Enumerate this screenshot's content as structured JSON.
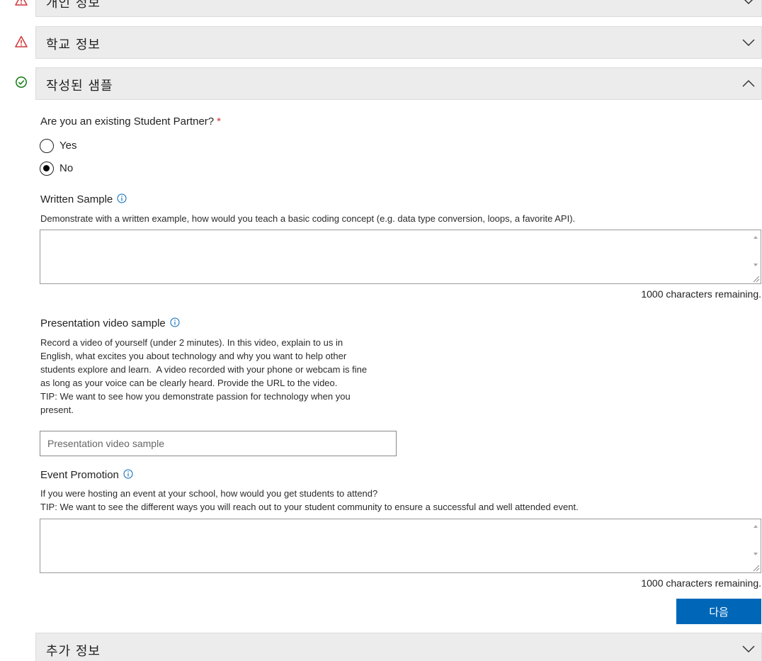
{
  "sections": {
    "personal_info": {
      "title": "개인 정보",
      "status": "warning"
    },
    "school_info": {
      "title": "학교 정보",
      "status": "warning"
    },
    "written_sample": {
      "title": "작성된 샘플",
      "status": "complete"
    },
    "additional_info": {
      "title": "추가 정보"
    }
  },
  "form": {
    "existing_partner": {
      "question": "Are you an existing Student Partner?",
      "required_mark": "*",
      "options": [
        "Yes",
        "No"
      ],
      "selected": "No"
    },
    "written_sample": {
      "label": "Written Sample",
      "description": "Demonstrate with a written example, how would you teach a basic coding concept (e.g. data type conversion, loops, a favorite API).",
      "value": "",
      "remaining": "1000 characters remaining."
    },
    "presentation_video": {
      "label": "Presentation video sample",
      "description_lines": [
        "Record a video of yourself (under 2 minutes). In this video, explain to us in",
        "English, what excites you about technology and why you want to help other",
        "students explore and learn.  A video recorded with your phone or webcam is fine",
        "as long as your voice can be clearly heard. Provide the URL to the video.",
        "TIP: We want to see how you demonstrate passion for technology when you",
        "present."
      ],
      "placeholder": "Presentation video sample",
      "value": ""
    },
    "event_promotion": {
      "label": "Event Promotion",
      "description_lines": [
        "If you were hosting an event at your school, how would you get students to attend?",
        "TIP: We want to see the different ways you will reach out to your student community to ensure a successful and well attended event."
      ],
      "value": "",
      "remaining": "1000 characters remaining."
    },
    "next_button": "다음"
  },
  "colors": {
    "warning": "#d13438",
    "complete": "#107c10",
    "primary": "#0067b8",
    "header_bg": "#ececec"
  }
}
